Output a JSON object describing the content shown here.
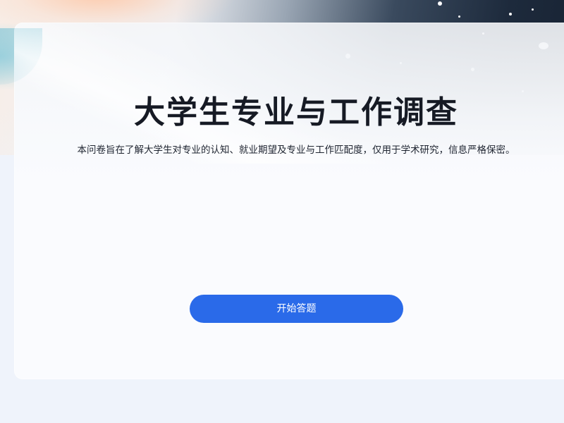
{
  "survey": {
    "title": "大学生专业与工作调查",
    "description": "本问卷旨在了解大学生对专业的认知、就业期望及专业与工作匹配度，仅用于学术研究，信息严格保密。",
    "start_button_label": "开始答题"
  },
  "colors": {
    "accent": "#2a6ae9",
    "title": "#161a24",
    "page_background": "#eff3fb",
    "card_background": "#fafbfe"
  }
}
